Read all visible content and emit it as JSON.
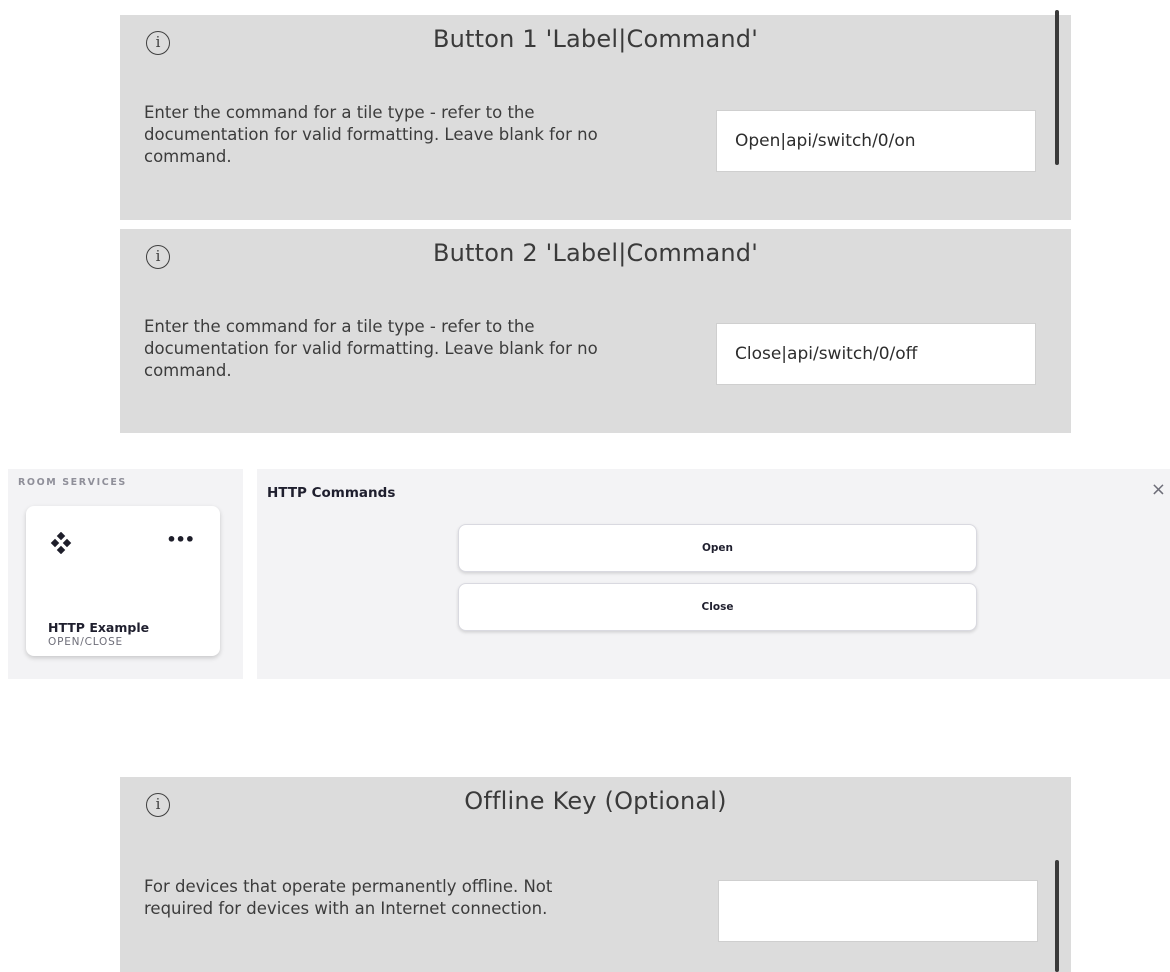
{
  "panels": [
    {
      "title": "Button 1 'Label|Command'",
      "description": [
        "Enter the command for a tile type - refer to the",
        "documentation for valid formatting.  Leave blank for no",
        "command."
      ],
      "value": "Open|api/switch/0/on"
    },
    {
      "title": "Button 2 'Label|Command'",
      "description": [
        "Enter the command for a tile type - refer to the",
        "documentation for valid formatting.  Leave blank for no",
        "command."
      ],
      "value": "Close|api/switch/0/off"
    },
    {
      "title": "Offline Key (Optional)",
      "description": [
        "For devices that operate permanently offline. Not",
        "required for devices with an Internet connection."
      ],
      "value": ""
    }
  ],
  "room_services": {
    "label": "ROOM SERVICES",
    "tile": {
      "name": "HTTP Example",
      "subtitle": "OPEN/CLOSE",
      "more": "•••",
      "icon": "diamond-cluster-icon"
    }
  },
  "http_commands": {
    "title": "HTTP Commands",
    "close": "×",
    "buttons": [
      "Open",
      "Close"
    ]
  },
  "colors": {
    "panel_bg": "#dcdcdc",
    "page_bg": "#ffffff",
    "tile_area_bg": "#f3f3f5"
  },
  "icons": {
    "info": "info-circle-icon",
    "close": "close-icon"
  }
}
